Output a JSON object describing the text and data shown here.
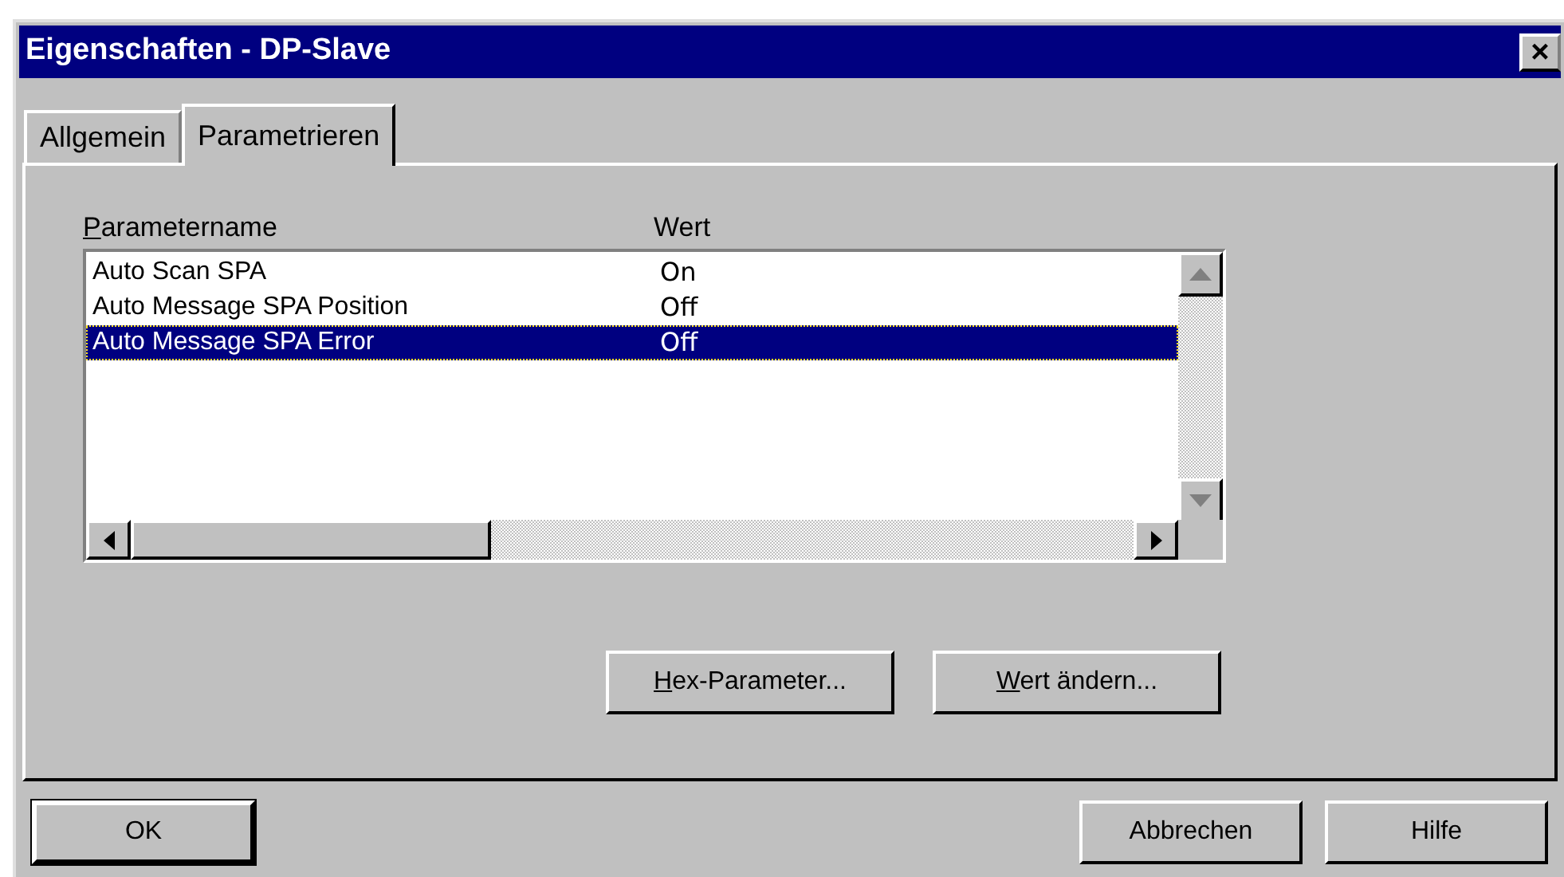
{
  "window": {
    "title": "Eigenschaften - DP-Slave",
    "close": "×"
  },
  "tabs": [
    {
      "label": "Allgemein",
      "selected": false
    },
    {
      "label": "Parametrieren",
      "selected": true
    }
  ],
  "list": {
    "columns": [
      {
        "label": "Parametername",
        "underline_first": true
      },
      {
        "label": "Wert",
        "underline_first": false
      }
    ],
    "rows": [
      {
        "name": "Auto Scan SPA",
        "value": "On",
        "selected": false
      },
      {
        "name": "Auto Message SPA Position",
        "value": "Off",
        "selected": false
      },
      {
        "name": "Auto Message SPA Error",
        "value": "Off",
        "selected": true
      }
    ]
  },
  "panel_buttons": [
    {
      "label": "Hex-Parameter...",
      "underline_first": true
    },
    {
      "label": "Wert ändern...",
      "underline_first": true
    }
  ],
  "buttons": [
    {
      "label": "OK",
      "default": true
    },
    {
      "label": "Abbrechen",
      "default": false
    },
    {
      "label": "Hilfe",
      "default": false
    }
  ]
}
